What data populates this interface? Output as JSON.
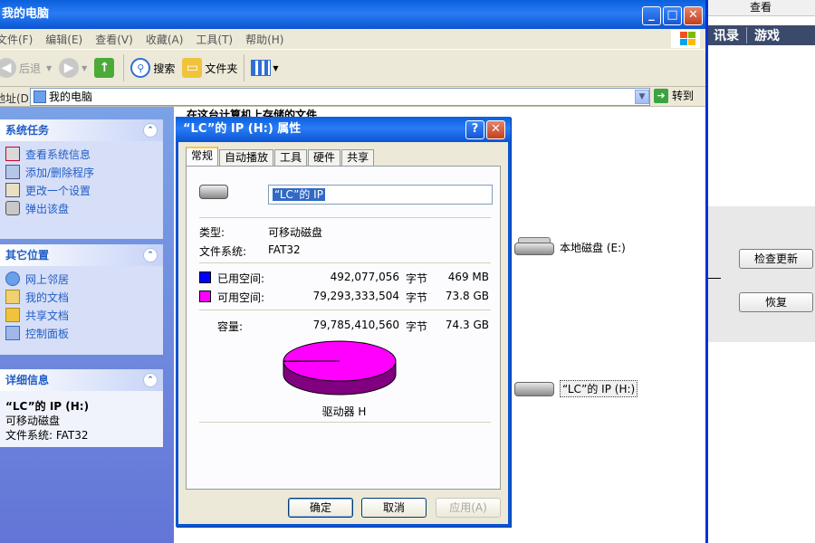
{
  "background_app": {
    "top_label": "查看",
    "nav_items": [
      "讯录",
      "游戏"
    ],
    "check_update_button": "检查更新",
    "restore_button": "恢复"
  },
  "explorer": {
    "title": "我的电脑",
    "menu": [
      "文件(F)",
      "编辑(E)",
      "查看(V)",
      "收藏(A)",
      "工具(T)",
      "帮助(H)"
    ],
    "toolbar": {
      "back": "后退",
      "search": "搜索",
      "folders": "文件夹"
    },
    "address": {
      "label": "地址(D)",
      "value": "我的电脑",
      "go": "转到"
    },
    "panels": {
      "system_tasks": {
        "title": "系统任务",
        "items": [
          "查看系统信息",
          "添加/删除程序",
          "更改一个设置",
          "弹出该盘"
        ]
      },
      "other_places": {
        "title": "其它位置",
        "items": [
          "网上邻居",
          "我的文档",
          "共享文档",
          "控制面板"
        ]
      },
      "details": {
        "title": "详细信息",
        "name": "“LC”的 IP (H:)",
        "type": "可移动磁盘",
        "fs": "文件系统: FAT32"
      }
    },
    "content": {
      "section_title": "在这台计算机上存储的文件",
      "drives": [
        {
          "label": "本地磁盘 (E:)"
        },
        {
          "label": "“LC”的 IP (H:)"
        }
      ]
    }
  },
  "dialog": {
    "title": "“LC”的 IP (H:) 属性",
    "tabs": [
      "常规",
      "自动播放",
      "工具",
      "硬件",
      "共享"
    ],
    "name_value": "“LC”的 IP",
    "type_label": "类型:",
    "type_value": "可移动磁盘",
    "fs_label": "文件系统:",
    "fs_value": "FAT32",
    "used": {
      "label": "已用空间:",
      "bytes": "492,077,056",
      "unit": "字节",
      "size": "469 MB",
      "color": "#0000ff"
    },
    "free": {
      "label": "可用空间:",
      "bytes": "79,293,333,504",
      "unit": "字节",
      "size": "73.8 GB",
      "color": "#ff00ff"
    },
    "capacity": {
      "label": "容量:",
      "bytes": "79,785,410,560",
      "unit": "字节",
      "size": "74.3 GB"
    },
    "drive_label": "驱动器 H",
    "used_fraction": 0.006,
    "buttons": {
      "ok": "确定",
      "cancel": "取消",
      "apply": "应用(A)"
    }
  }
}
